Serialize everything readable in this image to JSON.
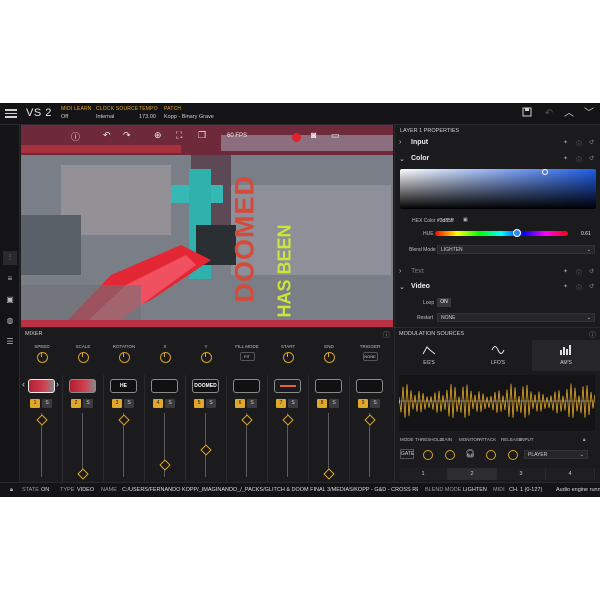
{
  "app": {
    "title": "VS 2"
  },
  "topbar": {
    "meta": [
      {
        "key": "MIDI LEARN",
        "value": "Off"
      },
      {
        "key": "CLOCK SOURCE",
        "value": "Internal"
      },
      {
        "key": "TEMPO",
        "value": "173.00"
      },
      {
        "key": "PATCH",
        "value": "Kopp - Binary Grave"
      }
    ]
  },
  "preview": {
    "fps": "60 FPS",
    "overlay_text": [
      "DOOMED",
      "HAS BEEN"
    ]
  },
  "properties": {
    "title": "LAYER 1 PROPERTIES",
    "sections": {
      "input": "Input",
      "color": "Color",
      "text": "Text",
      "video": "Video"
    },
    "hex_label": "HEX Color",
    "hex_value": "#3d85ff",
    "hue_label": "HUE",
    "hue_value": "0.61",
    "hue_fraction": 0.61,
    "blend_label": "Blend Mode",
    "blend_value": "LIGHTEN",
    "loop_label": "Loop",
    "loop_value": "ON",
    "restart_label": "Restart",
    "restart_value": "NONE",
    "picker_color": "#1f5de6"
  },
  "mixer": {
    "title": "MIXER",
    "knobs": [
      {
        "label": "SPEED"
      },
      {
        "label": "SCALE"
      },
      {
        "label": "ROTATION"
      },
      {
        "label": "X"
      },
      {
        "label": "Y"
      },
      {
        "label": "FILL MODE",
        "button": "FIT"
      },
      {
        "label": "START"
      },
      {
        "label": "END"
      },
      {
        "label": "TRIGGER",
        "button": "NONE"
      }
    ],
    "channels": [
      {
        "num": "1",
        "solo": "S",
        "thumb": "",
        "level": 0.95,
        "selected": true
      },
      {
        "num": "2",
        "solo": "S",
        "thumb": "",
        "level": 0.05
      },
      {
        "num": "3",
        "solo": "S",
        "thumb": "HE FUTUR",
        "level": 0.95
      },
      {
        "num": "4",
        "solo": "S",
        "thumb": "",
        "level": 0.2
      },
      {
        "num": "5",
        "solo": "S",
        "thumb": "DOOMED",
        "level": 0.45
      },
      {
        "num": "6",
        "solo": "S",
        "thumb": "",
        "level": 0.95
      },
      {
        "num": "7",
        "solo": "S",
        "thumb": "",
        "level": 0.95
      },
      {
        "num": "8",
        "solo": "S",
        "thumb": "",
        "level": 0.05
      },
      {
        "num": "9",
        "solo": "S",
        "thumb": "",
        "level": 0.95
      }
    ]
  },
  "modulation": {
    "title": "MODULATION SOURCES",
    "tabs": [
      "EG'S",
      "LFO'S",
      "AM'S"
    ],
    "controls": [
      "MODE",
      "THRESHOLD",
      "GAIN",
      "MONITOR",
      "ATTACK",
      "RELEASE",
      "INPUT"
    ],
    "mode_value": "GATE",
    "input_value": "PLAYER",
    "pages": [
      "1",
      "2",
      "3",
      "4"
    ]
  },
  "status": {
    "items": [
      {
        "key": "STATE",
        "value": "ON"
      },
      {
        "key": "TYPE",
        "value": "VIDEO"
      },
      {
        "key": "NAME",
        "value": "C:/USERS/FERNANDO KOPP/_IMAGINANDO_/_PACKS/GLITCH & DOOM FINAL 3/MEDIAS/KOPP - G&D - CROSS RED GLITCH.MP4"
      },
      {
        "key": "BLEND MODE",
        "value": "LIGHTEN"
      },
      {
        "key": "MIDI",
        "value": "CH. 1 (0-127)"
      }
    ],
    "message": "Audio engine running"
  },
  "colors": {
    "accent": "#e0a72b",
    "record": "#e0202a",
    "background": "#1b1b1d"
  }
}
